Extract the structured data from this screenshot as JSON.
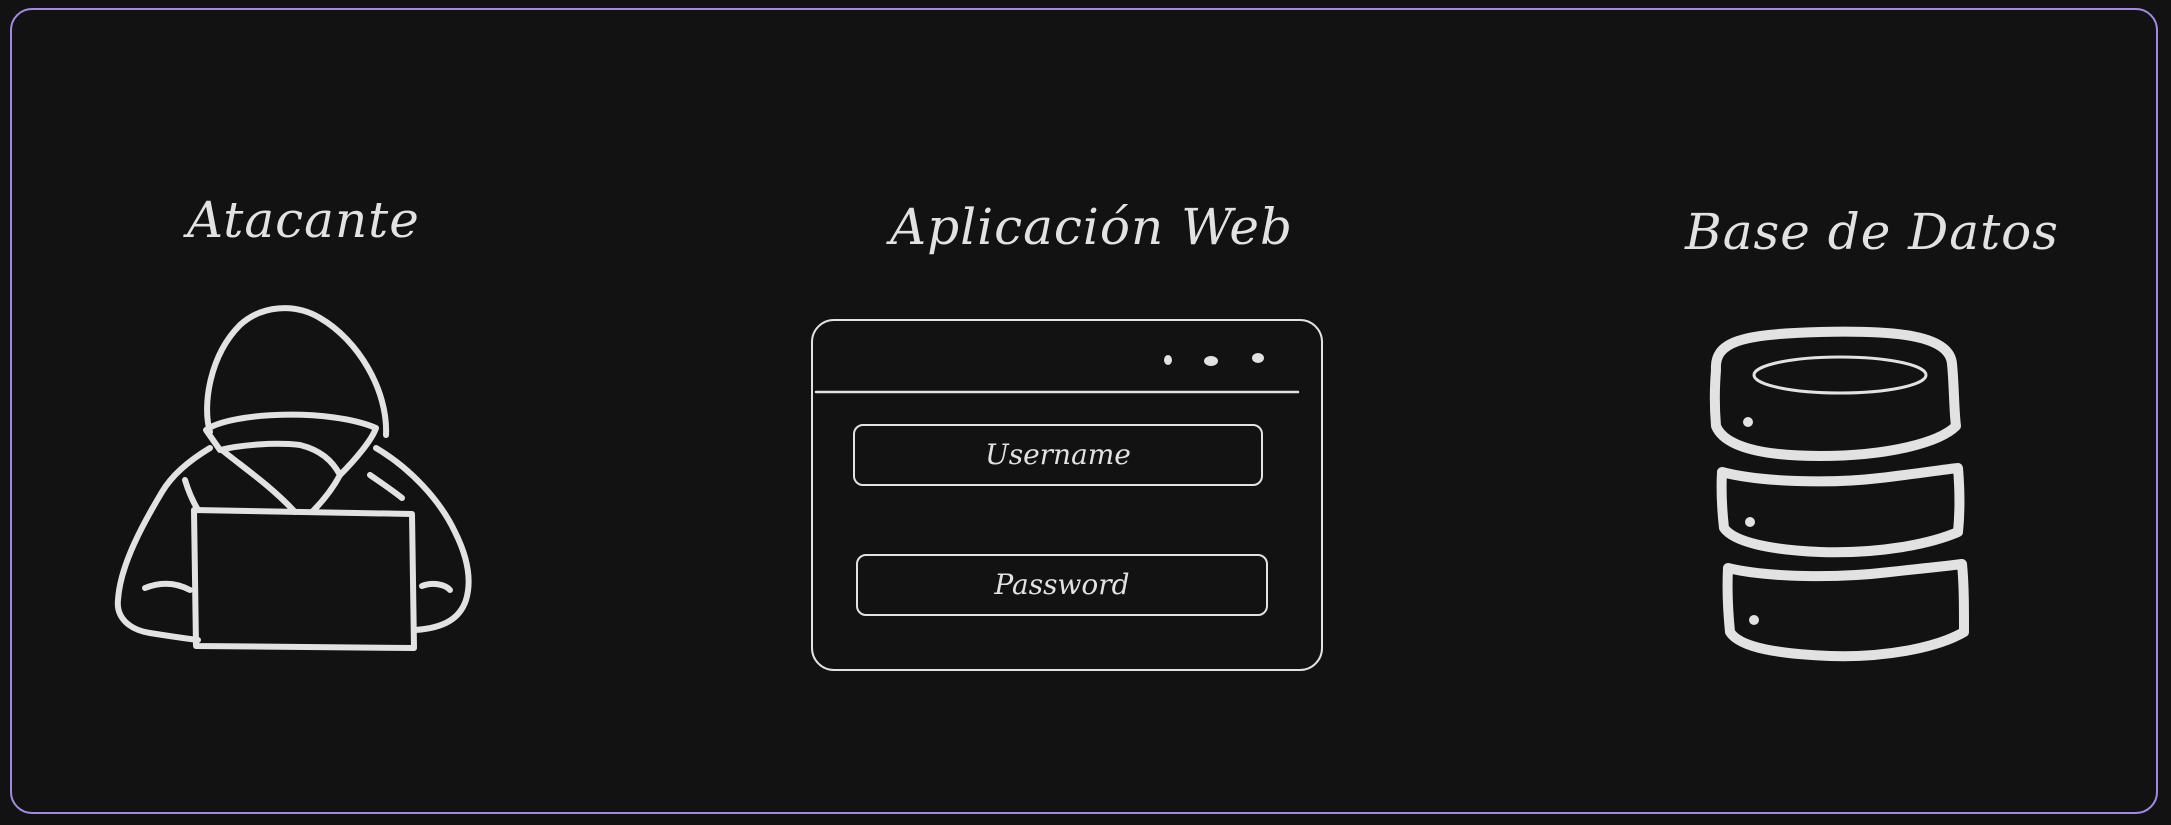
{
  "attacker": {
    "label": "Atacante"
  },
  "webapp": {
    "label": "Aplicación Web",
    "username_placeholder": "Username",
    "password_placeholder": "Password"
  },
  "database": {
    "label": "Base de Datos"
  },
  "colors": {
    "background": "#121212",
    "frame_border": "#a48ae6",
    "stroke": "#e2e2e2"
  }
}
